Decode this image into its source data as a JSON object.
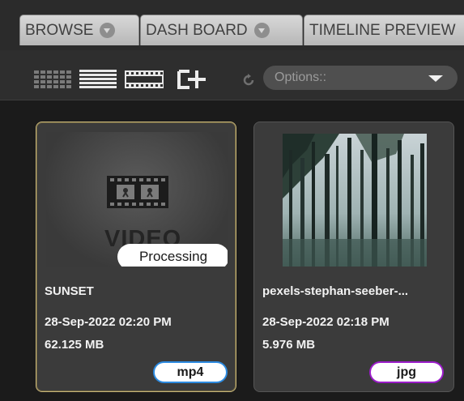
{
  "tabs": [
    {
      "label": "BROWSE"
    },
    {
      "label": "DASH BOARD"
    },
    {
      "label": "TIMELINE PREVIEW"
    }
  ],
  "toolbar": {
    "icons": [
      "grid-view-icon",
      "list-view-icon",
      "filmstrip-view-icon",
      "add-media-icon",
      "refresh-icon"
    ],
    "options_label": "Options::"
  },
  "files": [
    {
      "name": "SUNSET",
      "date": "28-Sep-2022 02:20 PM",
      "size": "62.125 MB",
      "ext": "mp4",
      "status": "Processing",
      "placeholder_text": "VIDEO",
      "selected": true,
      "ext_color": "#2c8ae0"
    },
    {
      "name": "pexels-stephan-seeber-...",
      "date": "28-Sep-2022 02:18 PM",
      "size": "5.976 MB",
      "ext": "jpg",
      "selected": false,
      "ext_color": "#9b1cc9"
    }
  ],
  "colors": {
    "selected_border": "#c8b67a",
    "background": "#1b1b1b"
  }
}
